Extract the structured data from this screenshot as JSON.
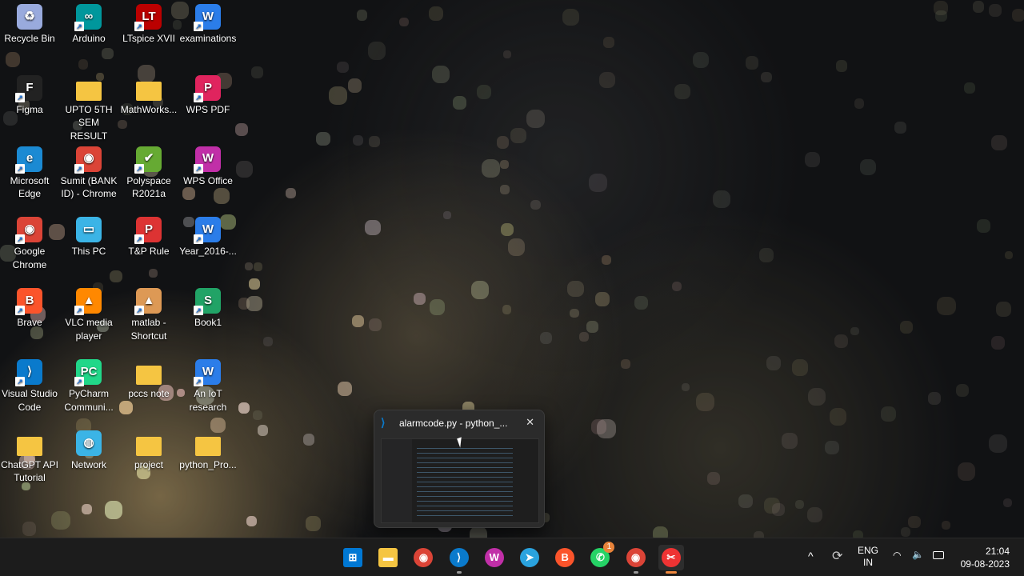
{
  "desktop": {
    "icons": [
      [
        "Recycle Bin",
        "#9ad",
        "♻",
        false
      ],
      [
        "Arduino",
        "#00979c",
        "∞",
        true
      ],
      [
        "LTspice XVII",
        "#b00",
        "LT",
        true
      ],
      [
        "examinations",
        "#2b7de9",
        "W",
        true
      ],
      [
        "Figma",
        "#222",
        "F",
        true
      ],
      [
        "UPTO 5TH SEM RESULT",
        "#f5c542",
        "",
        false
      ],
      [
        "MathWorks...",
        "#f5c542",
        "",
        false
      ],
      [
        "WPS PDF",
        "#e0245e",
        "P",
        true
      ],
      [
        "Microsoft Edge",
        "#1b8ad3",
        "e",
        true
      ],
      [
        "Sumit (BANK ID) - Chrome",
        "#db4437",
        "◉",
        true
      ],
      [
        "Polyspace R2021a",
        "#6a3",
        "✔",
        true
      ],
      [
        "WPS Office",
        "#c12fa8",
        "W",
        true
      ],
      [
        "Google Chrome",
        "#db4437",
        "◉",
        true
      ],
      [
        "This PC",
        "#3bb4e6",
        "▭",
        false
      ],
      [
        "T&P Rule",
        "#d33",
        "P",
        true
      ],
      [
        "Year_2016-...",
        "#2b7de9",
        "W",
        true
      ],
      [
        "Brave",
        "#fb542b",
        "B",
        true
      ],
      [
        "VLC media player",
        "#f80",
        "▲",
        true
      ],
      [
        "matlab - Shortcut",
        "#d95",
        "▲",
        true
      ],
      [
        "Book1",
        "#21a366",
        "S",
        true
      ],
      [
        "Visual Studio Code",
        "#0a7acc",
        "⟩",
        true
      ],
      [
        "PyCharm Communi...",
        "#21d789",
        "PC",
        true
      ],
      [
        "pccs note",
        "#f5c542",
        "",
        false
      ],
      [
        "An IoT research",
        "#2b7de9",
        "W",
        true
      ],
      [
        "ChatGPT API Tutorial",
        "#f5c542",
        "",
        false
      ],
      [
        "Network",
        "#3bb4e6",
        "◍",
        false
      ],
      [
        "project",
        "#f5c542",
        "",
        false
      ],
      [
        "python_Pro...",
        "#f5c542",
        "",
        false
      ]
    ]
  },
  "preview": {
    "title": "alarmcode.py - python_...",
    "close": "✕"
  },
  "taskbar": {
    "apps": [
      [
        "start",
        "#0078d4",
        "⊞",
        false
      ],
      [
        "file-explorer",
        "#f5c542",
        "▬",
        false
      ],
      [
        "chrome",
        "#db4437",
        "◉",
        false
      ],
      [
        "vscode",
        "#0a7acc",
        "⟩",
        true
      ],
      [
        "wps-office",
        "#c12fa8",
        "W",
        false
      ],
      [
        "telegram",
        "#2aa3df",
        "➤",
        false
      ],
      [
        "brave",
        "#fb542b",
        "B",
        false
      ],
      [
        "whatsapp",
        "#25d366",
        "✆",
        false
      ],
      [
        "chrome-profile",
        "#db4437",
        "◉",
        true
      ],
      [
        "snipping-tool",
        "#e33",
        "✂",
        true
      ]
    ],
    "whatsapp_badge": "1",
    "lang_top": "ENG",
    "lang_bottom": "IN",
    "time": "21:04",
    "date": "09-08-2023",
    "chevron": "^"
  }
}
